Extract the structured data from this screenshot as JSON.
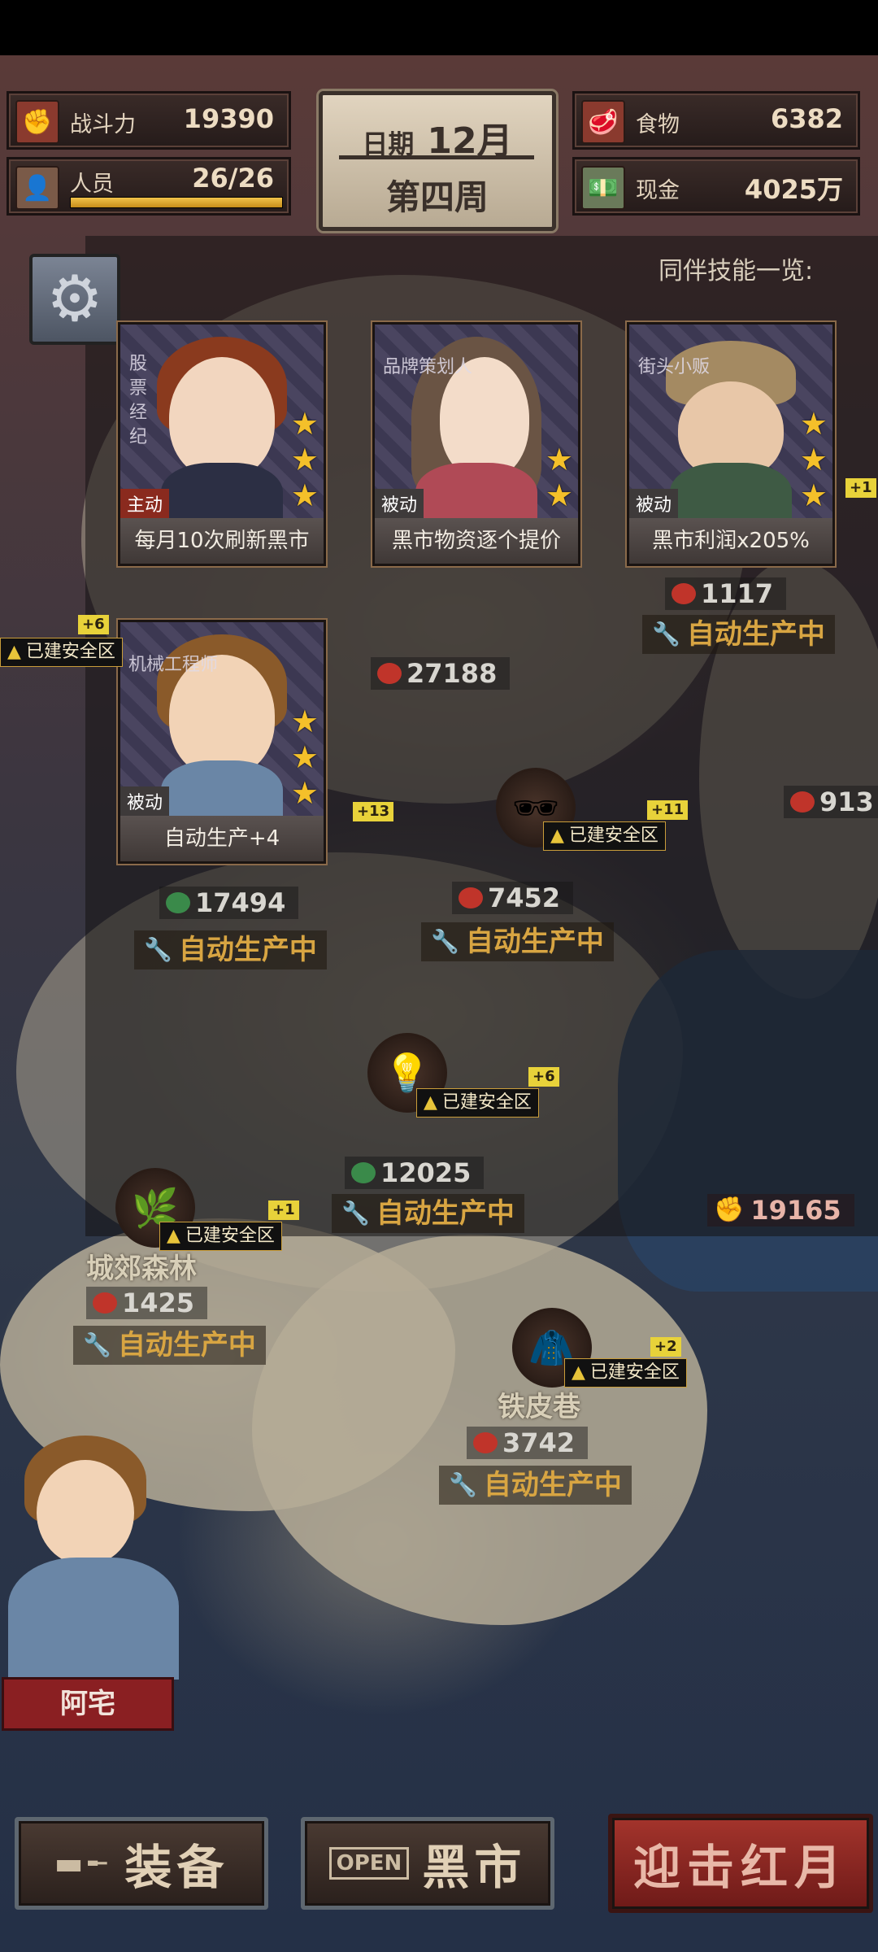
{
  "stats": {
    "combat": {
      "label": "战斗力",
      "value": "19390",
      "icon": "fist-icon"
    },
    "personnel": {
      "label": "人员",
      "value": "26/26",
      "progress": 1.0,
      "icon": "person-icon"
    },
    "food": {
      "label": "食物",
      "value": "6382",
      "icon": "meat-icon"
    },
    "cash": {
      "label": "现金",
      "value": "4025万",
      "icon": "money-icon"
    }
  },
  "date": {
    "label": "日期",
    "month": "12月",
    "week": "第四周"
  },
  "skills_title": "同伴技能一览:",
  "companions": [
    {
      "role": "股票经纪",
      "mode": "主动",
      "skill": "每月10次刷新黑市",
      "stars": 3
    },
    {
      "role": "品牌策划人",
      "mode": "被动",
      "skill": "黑市物资逐个提价",
      "stars": 2
    },
    {
      "role": "街头小贩",
      "mode": "被动",
      "skill": "黑市利润x205%",
      "stars": 3
    },
    {
      "role": "机械工程师",
      "mode": "被动",
      "skill": "自动生产+4",
      "stars": 3
    }
  ],
  "map": {
    "status_safe": "已建安全区",
    "status_auto": "自动生产中",
    "nodes": [
      {
        "place": "",
        "resource": "1117",
        "plus": "+1"
      },
      {
        "place": "",
        "resource": "27188",
        "plus": "+6"
      },
      {
        "place": "",
        "resource": "913",
        "plus": ""
      },
      {
        "place": "",
        "resource": "17494",
        "plus": "+13"
      },
      {
        "place": "",
        "resource": "7452",
        "plus": "+11"
      },
      {
        "place": "",
        "resource": "12025",
        "plus": "+6"
      },
      {
        "place": "城郊森林",
        "resource": "1425",
        "plus": "+1"
      },
      {
        "place": "铁皮巷",
        "resource": "3742",
        "plus": "+2"
      }
    ],
    "enemy_power": "19165"
  },
  "hero": {
    "name": "阿宅"
  },
  "buttons": {
    "equipment": "装备",
    "open_badge": "OPEN",
    "black_market": "黑市",
    "fight": "迎击红月"
  },
  "colors": {
    "accent_gold": "#d8a542",
    "danger_red": "#8a1f22",
    "star": "#f4c02a"
  }
}
